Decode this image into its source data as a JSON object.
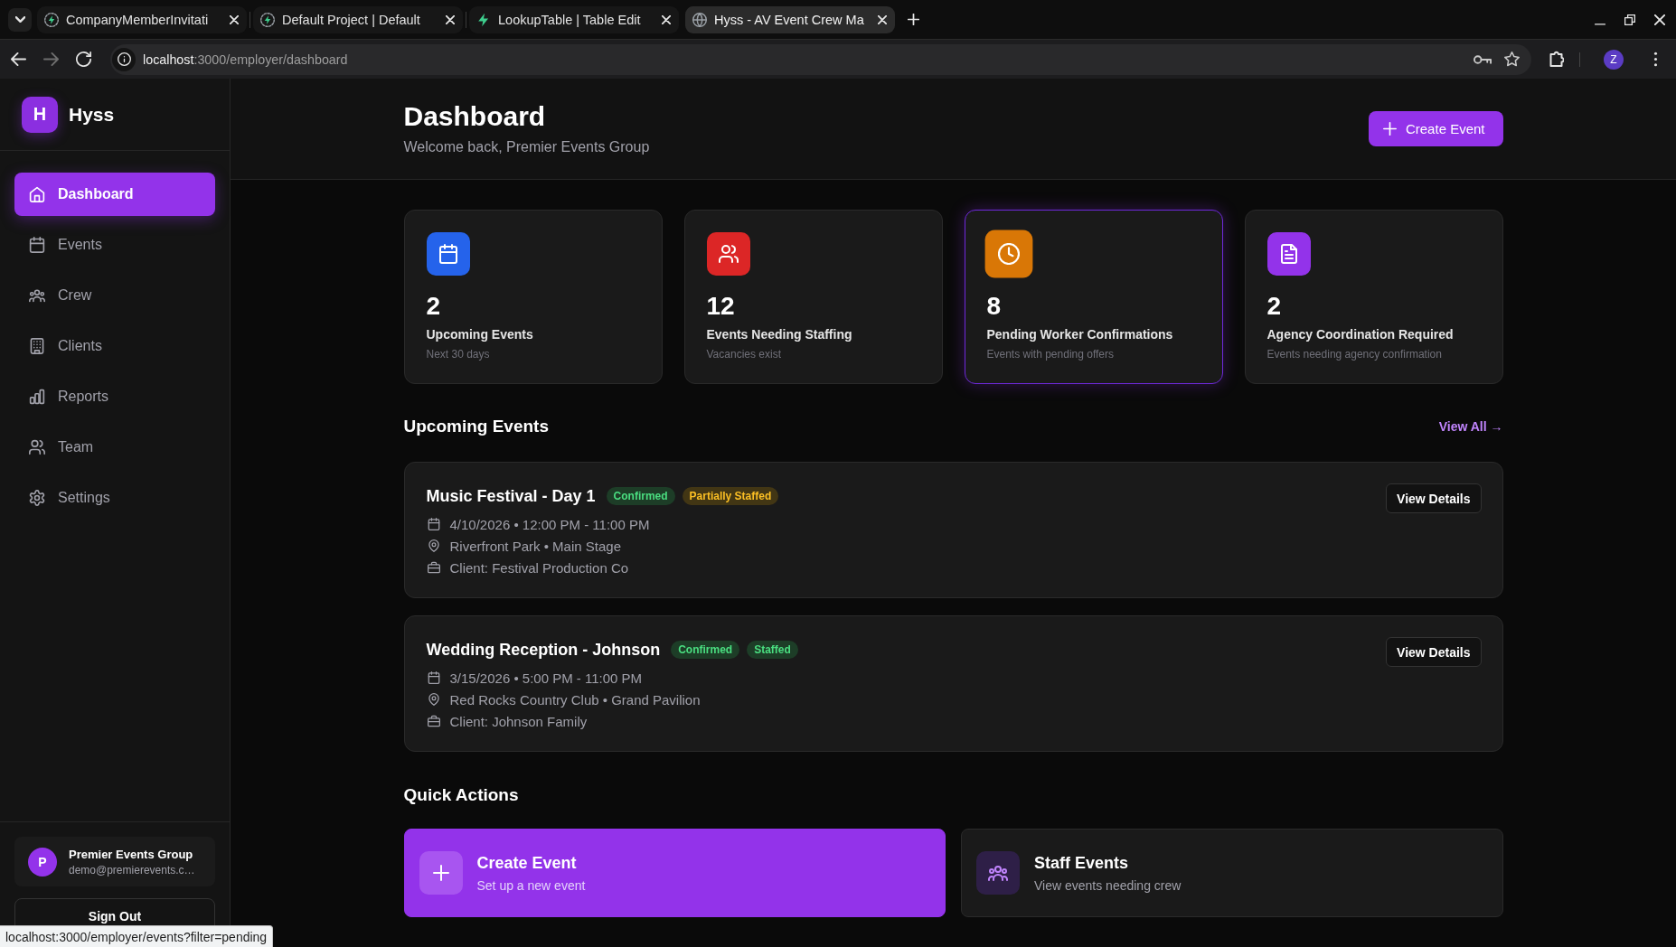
{
  "browser": {
    "tabs": [
      {
        "title": "CompanyMemberInvitati",
        "selected": false
      },
      {
        "title": "Default Project | Default",
        "selected": false
      },
      {
        "title": "LookupTable | Table Edit",
        "selected": false
      },
      {
        "title": "Hyss - AV Event Crew Ma",
        "selected": true
      }
    ],
    "address_bar": {
      "host": "localhost",
      "path": ":3000/employer/dashboard"
    },
    "profile_initial": "Z",
    "status_url": "localhost:3000/employer/events?filter=pending"
  },
  "sidebar": {
    "logo_letter": "H",
    "app_name": "Hyss",
    "items": [
      {
        "label": "Dashboard",
        "selected": true
      },
      {
        "label": "Events",
        "selected": false
      },
      {
        "label": "Crew",
        "selected": false
      },
      {
        "label": "Clients",
        "selected": false
      },
      {
        "label": "Reports",
        "selected": false
      },
      {
        "label": "Team",
        "selected": false
      },
      {
        "label": "Settings",
        "selected": false
      }
    ],
    "user": {
      "initial": "P",
      "name": "Premier Events Group",
      "email": "demo@premierevents.c…"
    },
    "sign_out": "Sign Out"
  },
  "header": {
    "title": "Dashboard",
    "subtitle": "Welcome back, Premier Events Group",
    "create_button": "Create Event"
  },
  "stats": [
    {
      "value": "2",
      "label": "Upcoming Events",
      "note": "Next 30 days",
      "color": "#2563eb",
      "highlighted": false
    },
    {
      "value": "12",
      "label": "Events Needing Staffing",
      "note": "Vacancies exist",
      "color": "#dc2626",
      "highlighted": false
    },
    {
      "value": "8",
      "label": "Pending Worker Confirmations",
      "note": "Events with pending offers",
      "color": "#d97706",
      "highlighted": true
    },
    {
      "value": "2",
      "label": "Agency Coordination Required",
      "note": "Events needing agency confirmation",
      "color": "#9333ea",
      "highlighted": false
    }
  ],
  "upcoming": {
    "title": "Upcoming Events",
    "view_all": "View All →",
    "events": [
      {
        "title": "Music Festival - Day 1",
        "badges": [
          {
            "label": "Confirmed",
            "kind": "success"
          },
          {
            "label": "Partially Staffed",
            "kind": "warning"
          }
        ],
        "date": "4/10/2026 • 12:00 PM - 11:00 PM",
        "location": "Riverfront Park • Main Stage",
        "client": "Client: Festival Production Co",
        "button": "View Details"
      },
      {
        "title": "Wedding Reception - Johnson",
        "badges": [
          {
            "label": "Confirmed",
            "kind": "success"
          },
          {
            "label": "Staffed",
            "kind": "success"
          }
        ],
        "date": "3/15/2026 • 5:00 PM - 11:00 PM",
        "location": "Red Rocks Country Club • Grand Pavilion",
        "client": "Client: Johnson Family",
        "button": "View Details"
      }
    ]
  },
  "quick_actions": {
    "title": "Quick Actions",
    "actions": [
      {
        "kind": "primary",
        "title": "Create Event",
        "subtitle": "Set up a new event"
      },
      {
        "kind": "secondary",
        "title": "Staff Events",
        "subtitle": "View events needing crew"
      }
    ]
  }
}
